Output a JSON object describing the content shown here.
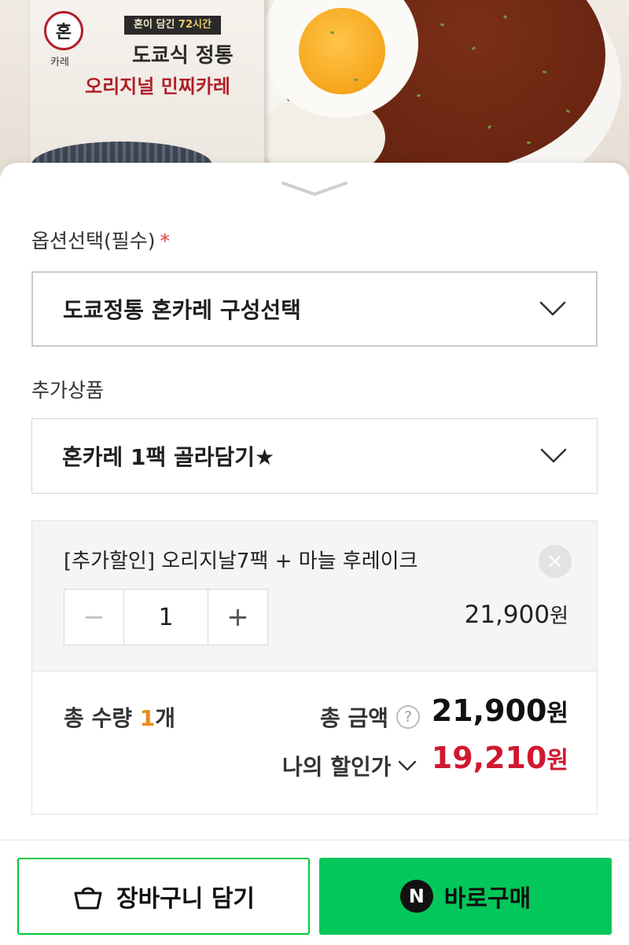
{
  "product_image": {
    "pouch_logo": "혼",
    "pouch_brand": "카레",
    "pouch_banner_prefix": "혼이 담긴",
    "pouch_banner_highlight": "72시간",
    "pouch_title_line1": "도쿄식 정통",
    "pouch_title_line2": "오리지널 민찌카레"
  },
  "option_select": {
    "label": "옵션선택(필수)",
    "required_mark": "*",
    "value": "도쿄정통 혼카레 구성선택"
  },
  "addon_select": {
    "label": "추가상품",
    "value": "혼카레 1팩 골라담기★"
  },
  "selected_item": {
    "name": "[추가할인] 오리지날7팩 + 마늘 후레이크",
    "remove_symbol": "×",
    "minus_symbol": "−",
    "plus_symbol": "+",
    "quantity": "1",
    "price": "21,900",
    "currency": "원"
  },
  "totals": {
    "qty_label": "총 수량",
    "qty_value": "1",
    "qty_unit": "개",
    "amount_label": "총 금액",
    "help_symbol": "?",
    "amount_value": "21,900",
    "currency": "원",
    "discount_label": "나의 할인가",
    "discount_value": "19,210"
  },
  "actions": {
    "cart_label": "장바구니 담기",
    "buy_badge": "N",
    "buy_label": "바로구매"
  },
  "colors": {
    "accent_green": "#03c75a",
    "discount_red": "#d0182f",
    "qty_orange": "#e88a1e",
    "required_red": "#e0413a"
  }
}
